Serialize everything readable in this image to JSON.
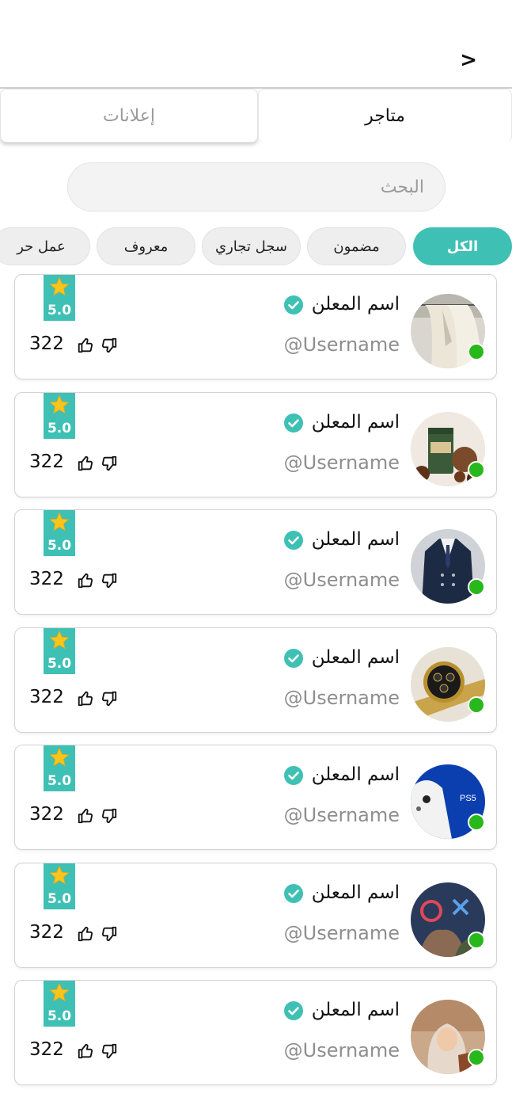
{
  "header": {
    "back_label": ">"
  },
  "tabs": [
    {
      "label": "متاجر",
      "active": true
    },
    {
      "label": "إعلانات",
      "active": false
    }
  ],
  "search": {
    "placeholder": "البحث"
  },
  "filters": [
    {
      "label": "الكل",
      "active": true
    },
    {
      "label": "مضمون",
      "active": false
    },
    {
      "label": "سجل تجاري",
      "active": false
    },
    {
      "label": "معروف",
      "active": false
    },
    {
      "label": "عمل حر",
      "active": false
    }
  ],
  "colors": {
    "accent": "#3fc0b4",
    "online": "#28b81c",
    "star": "#f7c51c"
  },
  "advertisers": [
    {
      "name": "اسم المعلن",
      "username": "@Username",
      "rating": "5.0",
      "votes": "322",
      "verified": true,
      "online": true,
      "avatar": "clothes-rack-photo"
    },
    {
      "name": "اسم المعلن",
      "username": "@Username",
      "rating": "5.0",
      "votes": "322",
      "verified": true,
      "online": true,
      "avatar": "coffee-bag-photo"
    },
    {
      "name": "اسم المعلن",
      "username": "@Username",
      "rating": "5.0",
      "votes": "322",
      "verified": true,
      "online": true,
      "avatar": "suit-photo"
    },
    {
      "name": "اسم المعلن",
      "username": "@Username",
      "rating": "5.0",
      "votes": "322",
      "verified": true,
      "online": true,
      "avatar": "watch-photo"
    },
    {
      "name": "اسم المعلن",
      "username": "@Username",
      "rating": "5.0",
      "votes": "322",
      "verified": true,
      "online": true,
      "avatar": "ps5-controller-photo"
    },
    {
      "name": "اسم المعلن",
      "username": "@Username",
      "rating": "5.0",
      "votes": "322",
      "verified": true,
      "online": true,
      "avatar": "games-collage-photo"
    },
    {
      "name": "اسم المعلن",
      "username": "@Username",
      "rating": "5.0",
      "votes": "322",
      "verified": true,
      "online": true,
      "avatar": "woman-hijab-photo"
    }
  ]
}
